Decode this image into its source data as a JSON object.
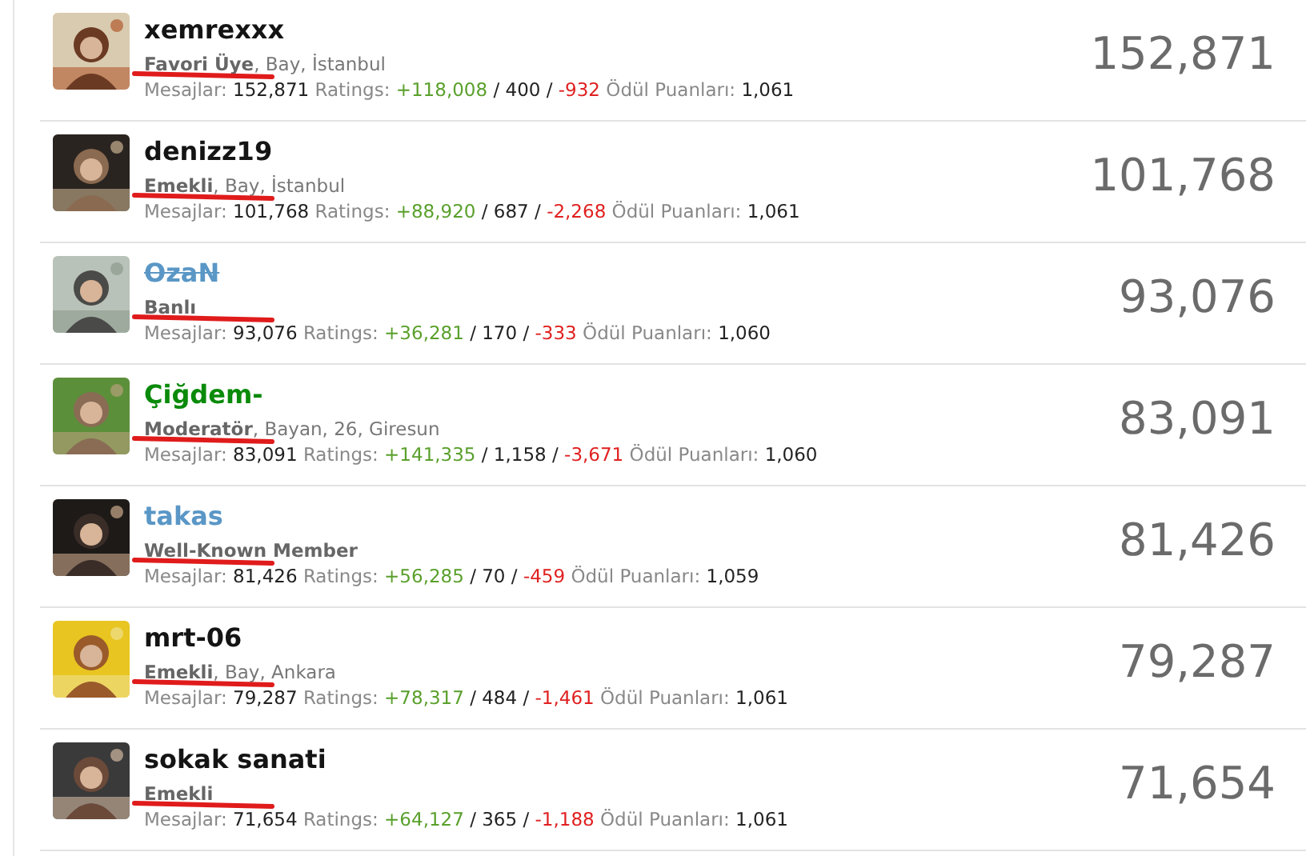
{
  "members": [
    {
      "name": "xemrexxx",
      "kind": "regular",
      "role": "Favori Üye",
      "details": ", Bay, İstanbul",
      "underlined": true,
      "mesajlar_label": "Mesajlar:",
      "mesajlar": "152,871",
      "ratings_label": "Ratings:",
      "positive": "+118,008",
      "neutral": "/ 400 /",
      "negative": "-932",
      "award_label": "Ödül Puanları:",
      "award": "1,061",
      "total": "152,871"
    },
    {
      "name": "denizz19",
      "kind": "regular",
      "role": "Emekli",
      "details": ", Bay, İstanbul",
      "underlined": true,
      "mesajlar_label": "Mesajlar:",
      "mesajlar": "101,768",
      "ratings_label": "Ratings:",
      "positive": "+88,920",
      "neutral": "/ 687 /",
      "negative": "-2,268",
      "award_label": "Ödül Puanları:",
      "award": "1,061",
      "total": "101,768"
    },
    {
      "name": "OzaN",
      "kind": "banned",
      "role": "Banlı",
      "underlined": true,
      "mesajlar_label": "Mesajlar:",
      "mesajlar": "93,076",
      "ratings_label": "Ratings:",
      "positive": "+36,281",
      "neutral": "/ 170 /",
      "negative": "-333",
      "award_label": "Ödül Puanları:",
      "award": "1,060",
      "total": "93,076"
    },
    {
      "name": "Çiğdem-",
      "kind": "moderator",
      "role": "Moderatör",
      "details": ", Bayan, 26, Giresun",
      "underlined": true,
      "mesajlar_label": "Mesajlar:",
      "mesajlar": "83,091",
      "ratings_label": "Ratings:",
      "positive": "+141,335",
      "neutral": "/ 1,158 /",
      "negative": "-3,671",
      "award_label": "Ödül Puanları:",
      "award": "1,060",
      "total": "83,091"
    },
    {
      "name": "takas",
      "kind": "notable",
      "role": "Well-Known Member",
      "underlined": true,
      "mesajlar_label": "Mesajlar:",
      "mesajlar": "81,426",
      "ratings_label": "Ratings:",
      "positive": "+56,285",
      "neutral": "/ 70 /",
      "negative": "-459",
      "award_label": "Ödül Puanları:",
      "award": "1,059",
      "total": "81,426"
    },
    {
      "name": "mrt-06",
      "kind": "regular",
      "role": "Emekli",
      "details": ", Bay, Ankara",
      "underlined": true,
      "mesajlar_label": "Mesajlar:",
      "mesajlar": "79,287",
      "ratings_label": "Ratings:",
      "positive": "+78,317",
      "neutral": "/ 484 /",
      "negative": "-1,461",
      "award_label": "Ödül Puanları:",
      "award": "1,061",
      "total": "79,287"
    },
    {
      "name": "sokak sanati",
      "kind": "regular",
      "role": "Emekli",
      "underlined": true,
      "mesajlar_label": "Mesajlar:",
      "mesajlar": "71,654",
      "ratings_label": "Ratings:",
      "positive": "+64,127",
      "neutral": "/ 365 /",
      "negative": "-1,188",
      "award_label": "Ödül Puanları:",
      "award": "1,061",
      "total": "71,654"
    }
  ]
}
